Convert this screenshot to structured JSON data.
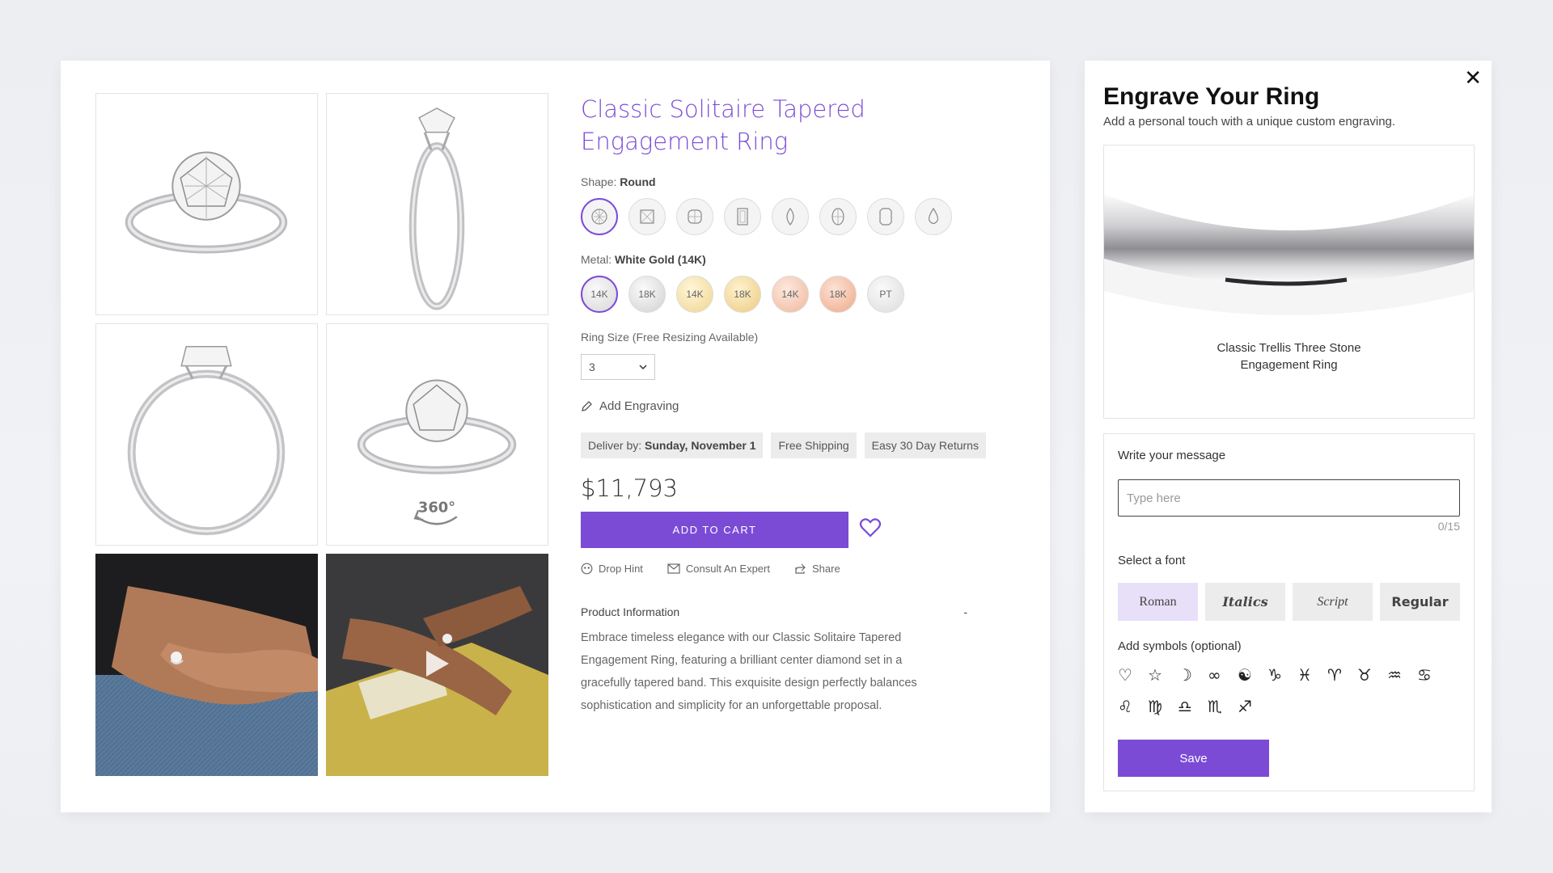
{
  "product": {
    "title": "Classic Solitaire Tapered Engagement Ring",
    "shape_label": "Shape:",
    "shape_value": "Round",
    "shapes": [
      "round",
      "princess",
      "cushion",
      "emerald",
      "marquise",
      "oval",
      "radiant",
      "pear"
    ],
    "metal_label": "Metal:",
    "metal_value": "White Gold (14K)",
    "metals": [
      {
        "label": "14K",
        "tone": "white"
      },
      {
        "label": "18K",
        "tone": "white"
      },
      {
        "label": "14K",
        "tone": "yellow"
      },
      {
        "label": "18K",
        "tone": "yellow"
      },
      {
        "label": "14K",
        "tone": "rose"
      },
      {
        "label": "18K",
        "tone": "rose"
      },
      {
        "label": "PT",
        "tone": "platinum"
      }
    ],
    "ring_size_label": "Ring Size (Free Resizing Available)",
    "ring_size_value": "3",
    "add_engraving": "Add Engraving",
    "deliver_by_label": "Deliver by:",
    "deliver_by_value": "Sunday, November 1",
    "free_shipping": "Free Shipping",
    "returns": "Easy 30 Day Returns",
    "price": "$11,793",
    "add_to_cart": "ADD TO CART",
    "actions": {
      "drop_hint": "Drop Hint",
      "consult": "Consult An Expert",
      "share": "Share"
    },
    "info_heading": "Product Information",
    "info_toggle": "-",
    "description": "Embrace timeless elegance with our Classic Solitaire Tapered Engagement Ring, featuring a brilliant center diamond set in a gracefully tapered band. This exquisite design perfectly balances sophistication and simplicity for an unforgettable proposal.",
    "gallery_badge": "360°"
  },
  "engrave": {
    "close": "✕",
    "title": "Engrave Your Ring",
    "subtitle": "Add a personal touch with a unique custom engraving.",
    "preview_caption_line1": "Classic Trellis Three Stone",
    "preview_caption_line2": "Engagement Ring",
    "message_label": "Write your message",
    "message_placeholder": "Type here",
    "counter": "0/15",
    "font_label": "Select a font",
    "fonts": [
      "Roman",
      "Italics",
      "Script",
      "Regular"
    ],
    "selected_font": "Roman",
    "symbols_label": "Add symbols (optional)",
    "symbols": [
      "♡",
      "☆",
      "☽",
      "∞",
      "☯",
      "♑",
      "♓",
      "♈",
      "♉",
      "♒",
      "♋",
      "♌",
      "♍",
      "♎",
      "♏",
      "♐"
    ],
    "save": "Save"
  },
  "colors": {
    "accent": "#7b4bd6",
    "selected_font_bg": "#e8e0f9",
    "tag_bg": "#ececec"
  }
}
